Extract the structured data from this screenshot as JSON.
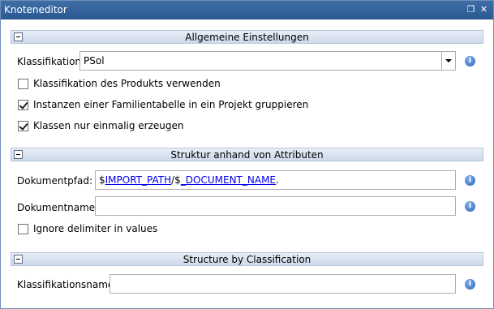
{
  "window": {
    "title": "Knoteneditor"
  },
  "sections": {
    "general": {
      "title": "Allgemeine Einstellungen"
    },
    "structure_attributes": {
      "title": "Struktur anhand von Attributen"
    },
    "structure_classification": {
      "title": "Structure by Classification"
    }
  },
  "general": {
    "classification_label": "Klassifikation:",
    "classification_value": "PSol",
    "checkboxes": [
      {
        "label": "Klassifikation des Produkts verwenden",
        "checked": false
      },
      {
        "label": "Instanzen einer Familientabelle in ein Projekt gruppieren",
        "checked": true
      },
      {
        "label": "Klassen nur einmalig erzeugen",
        "checked": true
      }
    ]
  },
  "attributes": {
    "docpath_label": "Dokumentpfad:",
    "docpath_parts": {
      "prefix": "$",
      "var1": "IMPORT_PATH",
      "sep": "/$",
      "var2": "_DOCUMENT_NAME",
      "suffix": "."
    },
    "docname_label": "Dokumentname:",
    "docname_value": "",
    "ignore_delimiter": {
      "label": "Ignore delimiter in values",
      "checked": false
    }
  },
  "classification": {
    "name_label": "Klassifikationsname:",
    "name_value": ""
  },
  "icons": {
    "info": "info-icon",
    "restore": "restore-icon",
    "close": "close-icon",
    "collapse": "collapse-icon"
  }
}
